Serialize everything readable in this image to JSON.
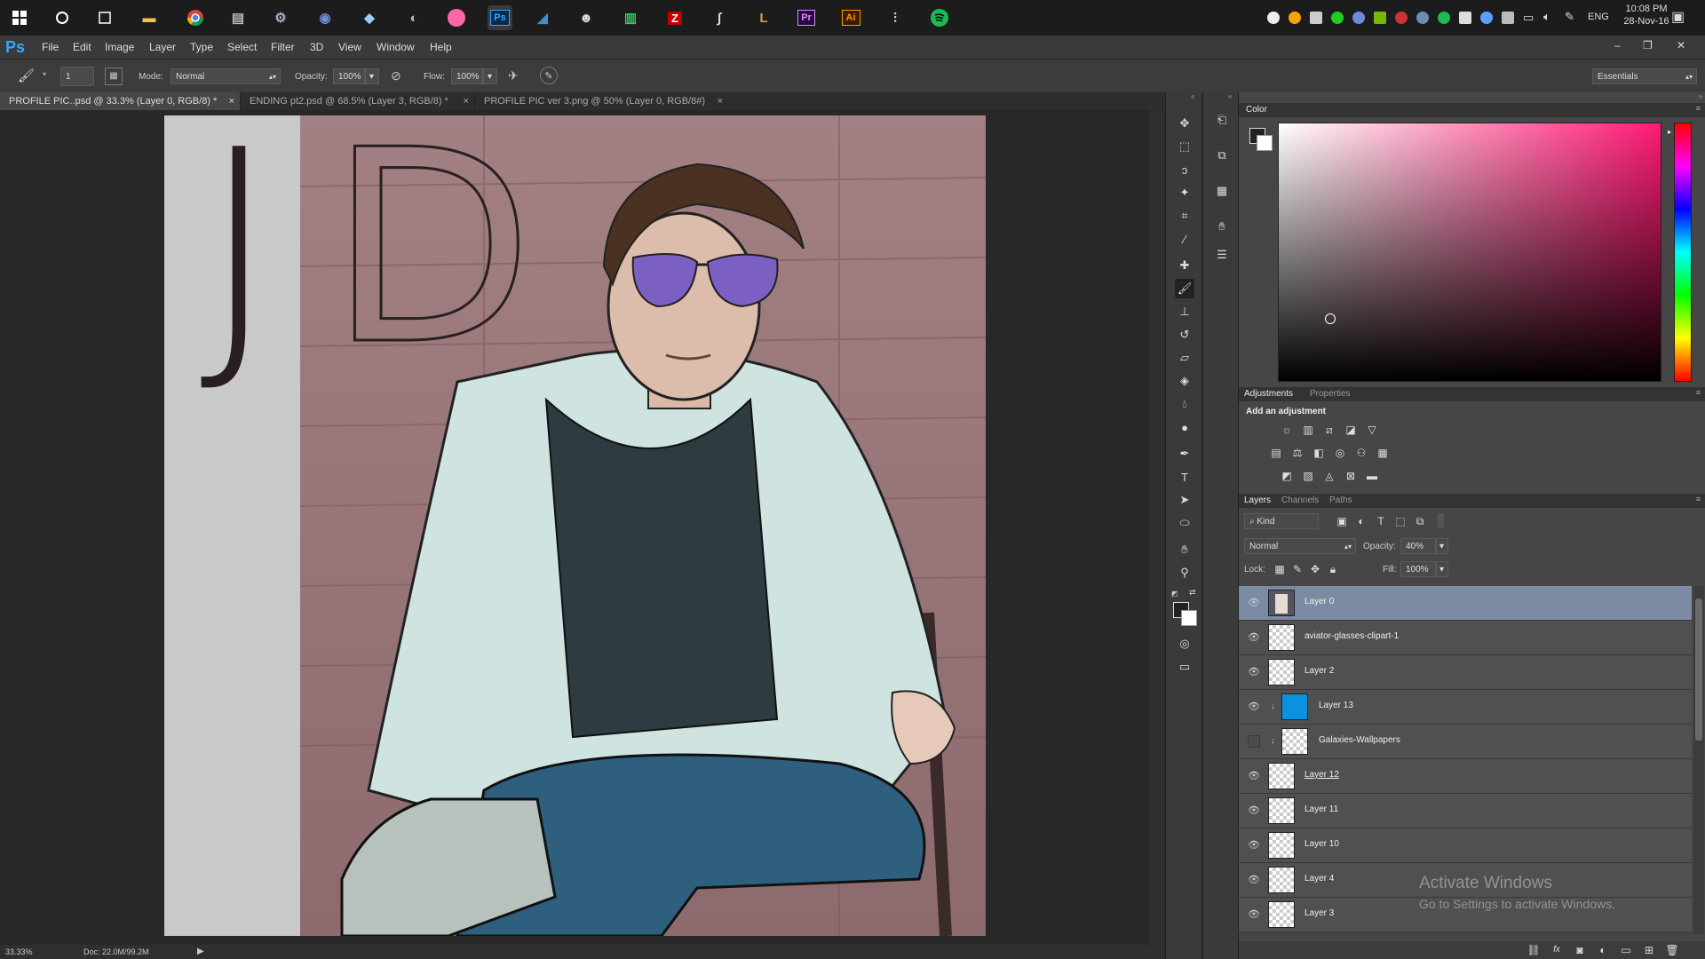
{
  "taskbar": {
    "apps": [
      "windows-start",
      "cortana",
      "task-view",
      "file-explorer",
      "chrome",
      "folder-app",
      "steam",
      "discord",
      "notes-app",
      "origin-app",
      "osu-app",
      "photoshop",
      "vpn-app",
      "bot-app",
      "music-app",
      "filezilla",
      "python-app",
      "league-app",
      "premiere",
      "illustrator",
      "equalizer-app",
      "spotify"
    ],
    "tray": {
      "language": "ENG",
      "time": "10:08 PM",
      "date": "28-Nov-16"
    }
  },
  "app": {
    "logo": "Ps"
  },
  "menu": [
    "File",
    "Edit",
    "Image",
    "Layer",
    "Type",
    "Select",
    "Filter",
    "3D",
    "View",
    "Window",
    "Help"
  ],
  "window_controls": {
    "minimize": "–",
    "restore": "❐",
    "close": "✕"
  },
  "options": {
    "brush_size": "1",
    "mode_label": "Mode:",
    "mode_value": "Normal",
    "opacity_label": "Opacity:",
    "opacity_value": "100%",
    "flow_label": "Flow:",
    "flow_value": "100%",
    "workspace": "Essentials"
  },
  "tabs": [
    {
      "label": "PROFILE PIC..psd @ 33.3% (Layer 0, RGB/8) *",
      "active": true
    },
    {
      "label": "ENDING pt2.psd @ 68.5% (Layer 3, RGB/8) *",
      "active": false
    },
    {
      "label": "PROFILE PIC ver 3.png @ 50% (Layer 0, RGB/8#)",
      "active": false
    }
  ],
  "artwork": {
    "letters": [
      "J",
      "D"
    ]
  },
  "status": {
    "zoom": "33.33%",
    "doc": "Doc: 22.0M/99.2M"
  },
  "panels": {
    "color": {
      "title": "Color"
    },
    "adjustments": {
      "tabs": [
        "Adjustments",
        "Properties"
      ],
      "add_label": "Add an adjustment"
    },
    "layers": {
      "tabs": [
        "Layers",
        "Channels",
        "Paths"
      ],
      "kind": "Kind",
      "blend": "Normal",
      "opacity_label": "Opacity:",
      "opacity_value": "40%",
      "lock_label": "Lock:",
      "fill_label": "Fill:",
      "fill_value": "100%",
      "items": [
        {
          "name": "Layer 0",
          "selected": true,
          "visible": true
        },
        {
          "name": "aviator-glasses-clipart-1",
          "selected": false,
          "visible": true
        },
        {
          "name": "Layer 2",
          "selected": false,
          "visible": true
        },
        {
          "name": "Layer 13",
          "selected": false,
          "visible": true
        },
        {
          "name": "Galaxies-Wallpapers",
          "selected": false,
          "visible": false
        },
        {
          "name": "Layer 12",
          "selected": false,
          "visible": true
        },
        {
          "name": "Layer 11",
          "selected": false,
          "visible": true
        },
        {
          "name": "Layer 10",
          "selected": false,
          "visible": true
        },
        {
          "name": "Layer 4",
          "selected": false,
          "visible": true
        },
        {
          "name": "Layer 3",
          "selected": false,
          "visible": true
        }
      ]
    }
  },
  "watermark": {
    "line1": "Activate Windows",
    "line2": "Go to Settings to activate Windows."
  }
}
